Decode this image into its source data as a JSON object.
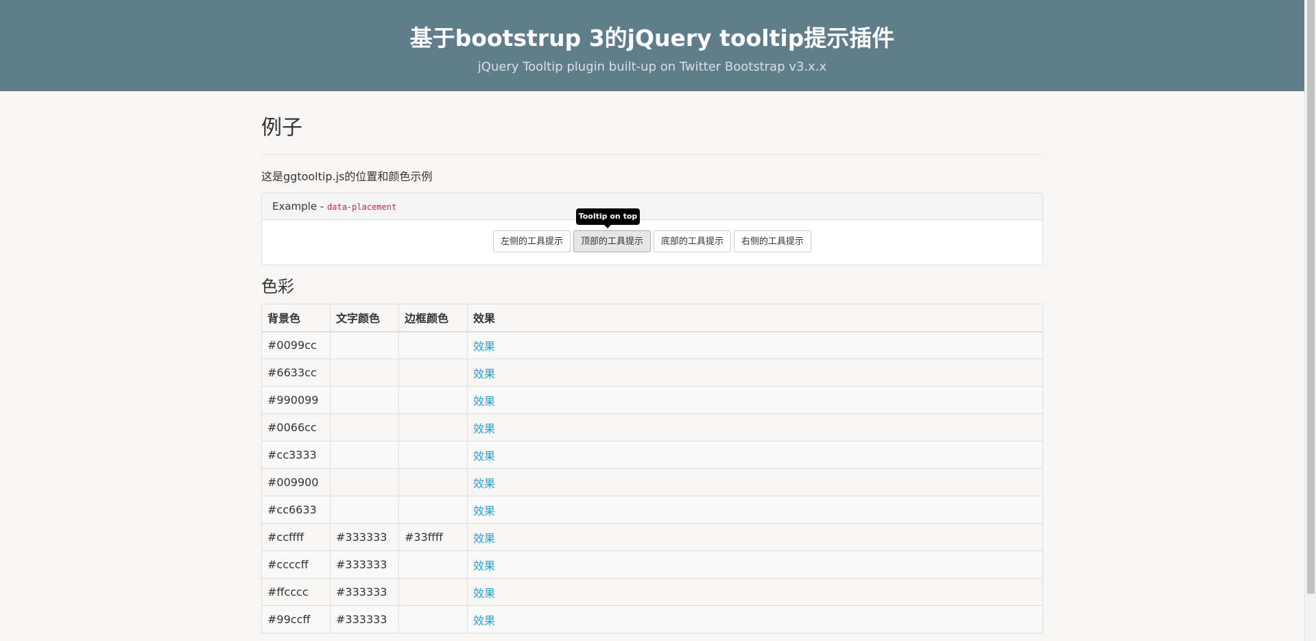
{
  "header": {
    "title": "基于bootstrup 3的jQuery tooltip提示插件",
    "subtitle": "jQuery Tooltip plugin built-up on Twitter Bootstrap v3.x.x"
  },
  "main": {
    "page_title": "例子",
    "intro": "这是ggtooltip.js的位置和颜色示例",
    "panel": {
      "heading_label": "Example - ",
      "heading_code": "data-placement",
      "buttons": [
        {
          "label": "左侧的工具提示",
          "active": false
        },
        {
          "label": "顶部的工具提示",
          "active": true
        },
        {
          "label": "底部的工具提示",
          "active": false
        },
        {
          "label": "右侧的工具提示",
          "active": false
        }
      ],
      "tooltip_text": "Tooltip on top"
    },
    "colors_section": {
      "title": "色彩",
      "columns": [
        "背景色",
        "文字颜色",
        "边框颜色",
        "效果"
      ],
      "rows": [
        {
          "bg": "#0099cc",
          "text": "",
          "border": "",
          "effect": "效果"
        },
        {
          "bg": "#6633cc",
          "text": "",
          "border": "",
          "effect": "效果"
        },
        {
          "bg": "#990099",
          "text": "",
          "border": "",
          "effect": "效果"
        },
        {
          "bg": "#0066cc",
          "text": "",
          "border": "",
          "effect": "效果"
        },
        {
          "bg": "#cc3333",
          "text": "",
          "border": "",
          "effect": "效果"
        },
        {
          "bg": "#009900",
          "text": "",
          "border": "",
          "effect": "效果"
        },
        {
          "bg": "#cc6633",
          "text": "",
          "border": "",
          "effect": "效果"
        },
        {
          "bg": "#ccffff",
          "text": "#333333",
          "border": "#33ffff",
          "effect": "效果"
        },
        {
          "bg": "#ccccff",
          "text": "#333333",
          "border": "",
          "effect": "效果"
        },
        {
          "bg": "#ffcccc",
          "text": "#333333",
          "border": "",
          "effect": "效果"
        },
        {
          "bg": "#99ccff",
          "text": "#333333",
          "border": "",
          "effect": "效果"
        }
      ]
    }
  },
  "theme": {
    "header_bg": "#607d8b",
    "link_color": "#2a9fd6",
    "tooltip_bg": "#000000"
  }
}
